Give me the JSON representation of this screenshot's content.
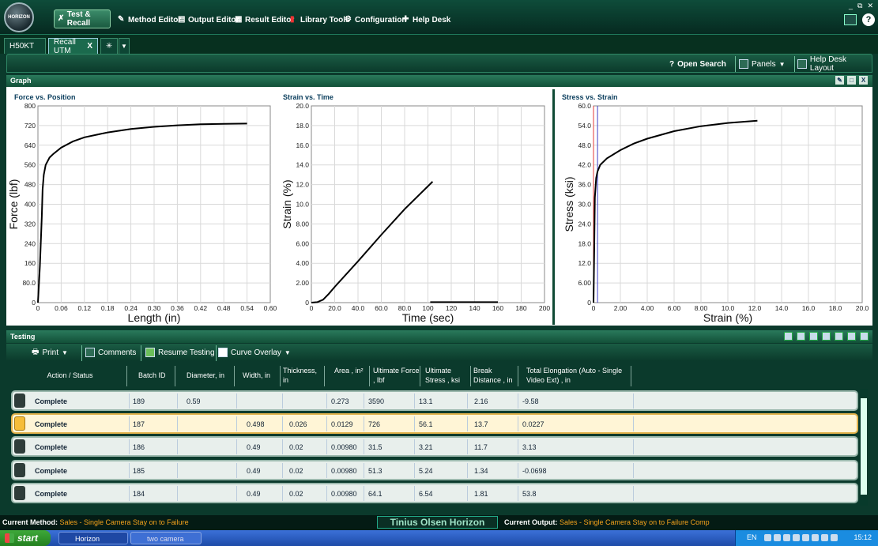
{
  "app": {
    "logo_text": "HORIZON",
    "menu": [
      {
        "label": "Test & Recall"
      },
      {
        "label": "Method Editor"
      },
      {
        "label": "Output Editor"
      },
      {
        "label": "Result Editor"
      },
      {
        "label": "Library Tools"
      },
      {
        "label": "Configuration"
      },
      {
        "label": "Help Desk"
      }
    ]
  },
  "tabs": {
    "items": [
      "H50KT",
      "Recall UTM"
    ],
    "close_glyph": "X"
  },
  "toolbar": {
    "open_search": "Open Search",
    "panels": "Panels",
    "help_desk_layout": "Help Desk Layout"
  },
  "graph": {
    "header": "Graph"
  },
  "chart_data": [
    {
      "type": "line",
      "title": "Force vs. Position",
      "xlabel": "Length (in)",
      "ylabel": "Force (lbf)",
      "xlim": [
        0,
        0.6
      ],
      "ylim": [
        0,
        800
      ],
      "x_ticks": [
        "0",
        "0.06",
        "0.12",
        "0.18",
        "0.24",
        "0.30",
        "0.36",
        "0.42",
        "0.48",
        "0.54",
        "0.60"
      ],
      "y_ticks": [
        "0",
        "80.0",
        "160",
        "240",
        "320",
        "400",
        "480",
        "560",
        "640",
        "720",
        "800"
      ],
      "series": [
        {
          "x": [
            0,
            0.005,
            0.01,
            0.012,
            0.015,
            0.02,
            0.03,
            0.04,
            0.06,
            0.09,
            0.12,
            0.18,
            0.24,
            0.3,
            0.36,
            0.42,
            0.48,
            0.54
          ],
          "y": [
            0,
            150,
            350,
            460,
            520,
            560,
            590,
            605,
            630,
            655,
            672,
            692,
            706,
            715,
            721,
            725,
            727,
            728
          ]
        }
      ]
    },
    {
      "type": "line",
      "title": "Strain vs. Time",
      "xlabel": "Time (sec)",
      "ylabel": "Strain (%)",
      "xlim": [
        0,
        200
      ],
      "ylim": [
        0,
        20.0
      ],
      "x_ticks": [
        "0",
        "20.0",
        "40.0",
        "60.0",
        "80.0",
        "100",
        "120",
        "140",
        "160",
        "180",
        "200"
      ],
      "y_ticks": [
        "0",
        "2.00",
        "4.00",
        "6.00",
        "8.00",
        "10.0",
        "12.0",
        "14.0",
        "16.0",
        "18.0",
        "20.0"
      ],
      "series": [
        {
          "x": [
            0,
            5,
            10,
            15,
            20,
            40,
            60,
            80,
            104
          ],
          "y": [
            0,
            0.05,
            0.3,
            0.9,
            1.6,
            4.2,
            6.9,
            9.5,
            12.3
          ]
        },
        {
          "x": [
            102,
            160
          ],
          "y": [
            0.05,
            0.05
          ]
        }
      ]
    },
    {
      "type": "line",
      "title": "Stress vs. Strain",
      "xlabel": "Strain (%)",
      "ylabel": "Stress (ksi)",
      "xlim": [
        0,
        20.0
      ],
      "ylim": [
        0,
        60.0
      ],
      "x_ticks": [
        "0",
        "2.00",
        "4.00",
        "6.00",
        "8.00",
        "10.0",
        "12.0",
        "14.0",
        "16.0",
        "18.0",
        "20.0"
      ],
      "y_ticks": [
        "0",
        "6.00",
        "12.0",
        "18.0",
        "24.0",
        "30.0",
        "36.0",
        "42.0",
        "48.0",
        "54.0",
        "60.0"
      ],
      "series": [
        {
          "x": [
            0,
            0.05,
            0.1,
            0.2,
            0.3,
            0.5,
            1,
            2,
            3,
            4,
            6,
            8,
            10,
            12.2
          ],
          "y": [
            0,
            16,
            32,
            38,
            40,
            42,
            44,
            46.5,
            48.5,
            50,
            52.3,
            53.8,
            54.8,
            55.5
          ]
        }
      ],
      "markers": [
        {
          "x": 0.0,
          "color": "#e03a3a"
        },
        {
          "x": 0.3,
          "color": "#4040c8"
        }
      ]
    }
  ],
  "testing": {
    "header": "Testing",
    "toolbar": {
      "print": "Print",
      "comments": "Comments",
      "resume": "Resume Testing",
      "curve_overlay": "Curve Overlay"
    },
    "columns": [
      "Action / Status",
      "Batch ID",
      "Diameter, in",
      "Width, in",
      "Thickness, in",
      "Area , in²",
      "Ultimate Force , lbf",
      "Ultimate Stress , ksi",
      "Break Distance , in",
      "Total Elongation (Auto - Single Video Ext) , in"
    ],
    "rows": [
      {
        "status": "Complete",
        "batch": "189",
        "diameter": "0.59",
        "width": "",
        "thickness": "",
        "area": "0.273",
        "force": "3590",
        "stress": "13.1",
        "break": "2.16",
        "elong": "-9.58"
      },
      {
        "status": "Complete",
        "batch": "187",
        "diameter": "",
        "width": "0.498",
        "thickness": "0.026",
        "area": "0.0129",
        "force": "726",
        "stress": "56.1",
        "break": "13.7",
        "elong": "0.0227"
      },
      {
        "status": "Complete",
        "batch": "186",
        "diameter": "",
        "width": "0.49",
        "thickness": "0.02",
        "area": "0.00980",
        "force": "31.5",
        "stress": "3.21",
        "break": "11.7",
        "elong": "3.13"
      },
      {
        "status": "Complete",
        "batch": "185",
        "diameter": "",
        "width": "0.49",
        "thickness": "0.02",
        "area": "0.00980",
        "force": "51.3",
        "stress": "5.24",
        "break": "1.34",
        "elong": "-0.0698"
      },
      {
        "status": "Complete",
        "batch": "184",
        "diameter": "",
        "width": "0.49",
        "thickness": "0.02",
        "area": "0.00980",
        "force": "64.1",
        "stress": "6.54",
        "break": "1.81",
        "elong": "53.8"
      }
    ]
  },
  "status_bar": {
    "method_label": "Current Method:",
    "method_value": "Sales - Single Camera Stay on to Failure",
    "brand": "Tinius Olsen Horizon",
    "output_label": "Current Output:",
    "output_value": "Sales - Single Camera Stay on to Failure Comp"
  },
  "taskbar": {
    "start": "start",
    "tasks": [
      "Horizon",
      "two camera res..."
    ],
    "lang": "EN",
    "time": "15:12"
  }
}
